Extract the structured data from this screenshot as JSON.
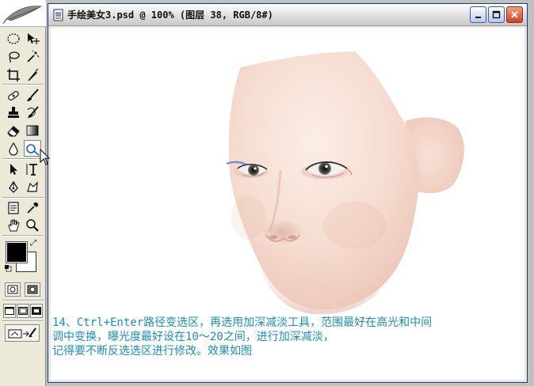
{
  "document": {
    "title": "手绘美女3.psd @ 100% (图层 38, RGB/8#)"
  },
  "caption": {
    "line1": "14、Ctrl+Enter路径变选区，再选用加深减淡工具，范围最好在高光和中间",
    "line2": "调中变换，曝光度最好设在10～20之间，进行加深减淡，",
    "line3": "记得要不断反选选区进行修改。效果如图"
  },
  "colors": {
    "foreground": "#000000",
    "background": "#ffffff",
    "caption_text": "#1a8fb8",
    "skin": "#f3d6c9"
  },
  "toolbox": {
    "active_tool": "dodge-tool"
  }
}
